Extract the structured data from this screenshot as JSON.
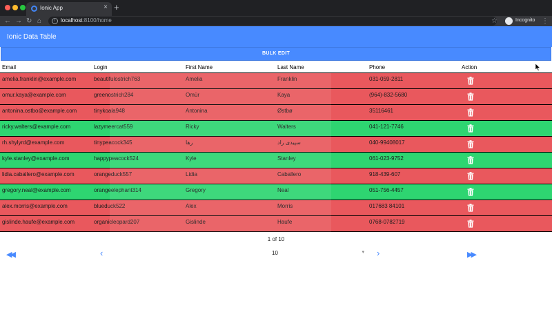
{
  "browser": {
    "tab_title": "Ionic App",
    "tab_close": "×",
    "new_tab": "+",
    "url_host": "localhost",
    "url_rest": ":8100/home",
    "incognito_label": "Incognito",
    "nav": {
      "back": "←",
      "forward": "→",
      "reload": "↻",
      "home": "⌂"
    },
    "star": "☆",
    "menu": "⋮"
  },
  "app": {
    "title": "Ionic Data Table",
    "bulk_edit_label": "BULK EDIT"
  },
  "table": {
    "columns": [
      "Email",
      "Login",
      "First Name",
      "Last Name",
      "Phone",
      "Action"
    ],
    "rows": [
      {
        "email": "amelia.franklin@example.com",
        "login": "beautifulostrich763",
        "first": "Amelia",
        "last": "Franklin",
        "phone": "031-059-2811",
        "status": "red"
      },
      {
        "email": "omur.kaya@example.com",
        "login": "greenostrich284",
        "first": "Omür",
        "last": "Kaya",
        "phone": "(964)-832-5680",
        "status": "red"
      },
      {
        "email": "antonina.ostbo@example.com",
        "login": "tinykoala948",
        "first": "Antonina",
        "last": "Østbø",
        "phone": "35116461",
        "status": "red"
      },
      {
        "email": "ricky.walters@example.com",
        "login": "lazymeercat559",
        "first": "Ricky",
        "last": "Walters",
        "phone": "041-121-7746",
        "status": "green"
      },
      {
        "email": "rh.shylyrd@example.com",
        "login": "tinypeacock345",
        "first": "رها",
        "last": "سپیدی راد",
        "phone": "040-99408017",
        "status": "red"
      },
      {
        "email": "kyle.stanley@example.com",
        "login": "happypeacock524",
        "first": "Kyle",
        "last": "Stanley",
        "phone": "061-023-9752",
        "status": "green"
      },
      {
        "email": "lidia.caballero@example.com",
        "login": "orangeduck557",
        "first": "Lidia",
        "last": "Caballero",
        "phone": "918-439-607",
        "status": "red"
      },
      {
        "email": "gregory.neal@example.com",
        "login": "orangeelephant314",
        "first": "Gregory",
        "last": "Neal",
        "phone": "051-756-4457",
        "status": "green"
      },
      {
        "email": "alex.morris@example.com",
        "login": "blueduck522",
        "first": "Alex",
        "last": "Morris",
        "phone": "017683 84101",
        "status": "red"
      },
      {
        "email": "gislinde.haufe@example.com",
        "login": "organicleopard207",
        "first": "Gislinde",
        "last": "Haufe",
        "phone": "0768-0782719",
        "status": "red"
      }
    ]
  },
  "pagination": {
    "page_label": "1 of 10",
    "page_size": "10",
    "first": "◀◀",
    "prev": "‹",
    "next": "›",
    "last": "▶▶",
    "caret": "▾"
  },
  "colors": {
    "toolbar": "#488aff",
    "row_red": "#e9585d",
    "row_green": "#2ed571"
  }
}
